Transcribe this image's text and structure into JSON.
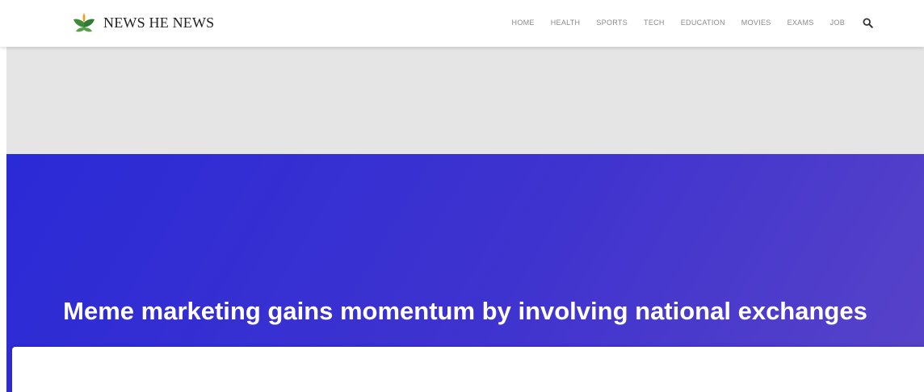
{
  "brand": {
    "name": "NEWS HE NEWS",
    "logo_icon": "lotus-logo-icon"
  },
  "nav": {
    "items": [
      {
        "label": "HOME"
      },
      {
        "label": "HEALTH"
      },
      {
        "label": "SPORTS"
      },
      {
        "label": "TECH"
      },
      {
        "label": "EDUCATION"
      },
      {
        "label": "MOVIES"
      },
      {
        "label": "EXAMS"
      },
      {
        "label": "JOB"
      }
    ],
    "search_icon": "search-icon"
  },
  "hero": {
    "title": "Meme marketing gains momentum by involving national exchanges"
  },
  "colors": {
    "hero_start": "#2a2ad6",
    "hero_end": "#5843c8",
    "ad_band": "#e5e5e5",
    "nav_text": "#8a8a8a"
  }
}
